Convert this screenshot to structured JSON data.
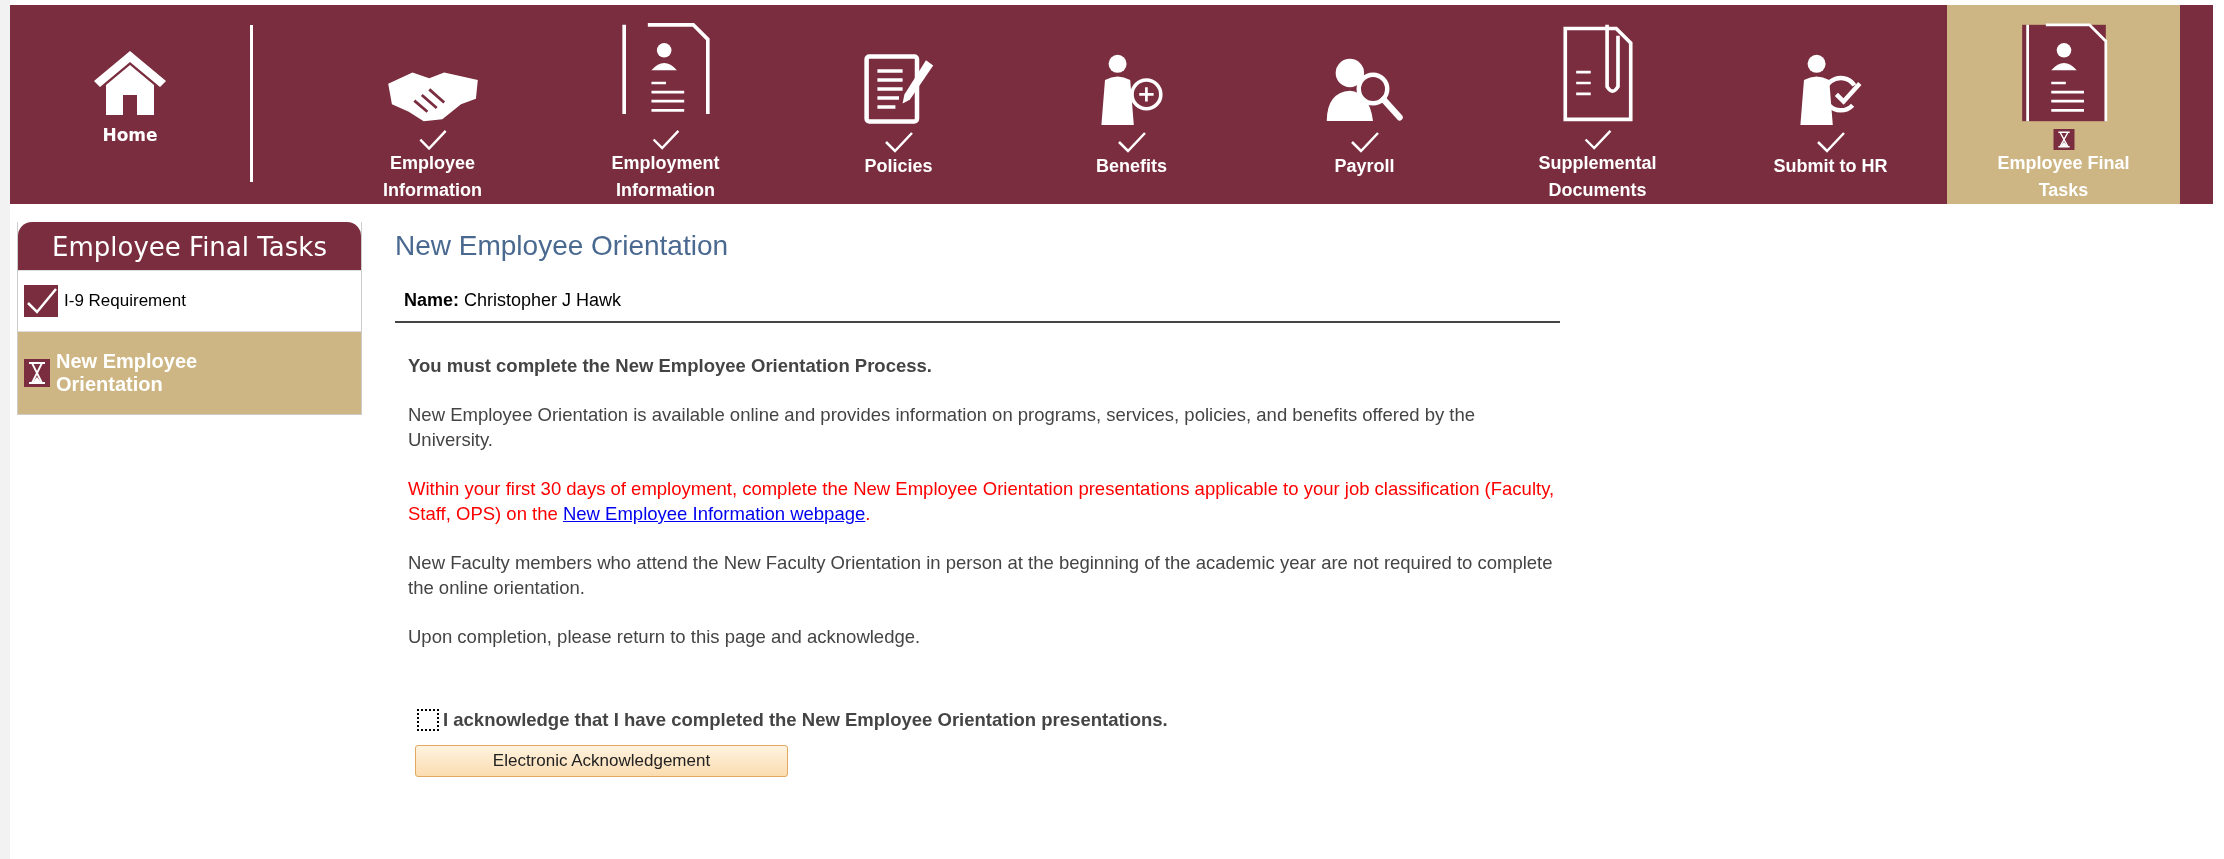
{
  "nav": {
    "home": {
      "label": "Home"
    },
    "tabs": [
      {
        "label": "Employee Information",
        "completed": true,
        "selected": false
      },
      {
        "label": "Employment Information",
        "completed": true,
        "selected": false
      },
      {
        "label": "Policies",
        "completed": true,
        "selected": false
      },
      {
        "label": "Benefits",
        "completed": true,
        "selected": false
      },
      {
        "label": "Payroll",
        "completed": true,
        "selected": false
      },
      {
        "label": "Supplemental Documents",
        "completed": true,
        "selected": false
      },
      {
        "label": "Submit to HR",
        "completed": true,
        "selected": false
      },
      {
        "label": "Employee Final Tasks",
        "completed": false,
        "selected": true
      }
    ]
  },
  "sidebar": {
    "title": "Employee Final Tasks",
    "items": [
      {
        "label": "I-9 Requirement",
        "completed": true,
        "selected": false
      },
      {
        "label": "New Employee Orientation",
        "completed": false,
        "selected": true
      }
    ]
  },
  "content": {
    "title": "New Employee Orientation",
    "name_label": "Name:",
    "name_value": "Christopher J Hawk",
    "paragraphs": [
      {
        "kind": "bold",
        "text": "You must complete the New Employee Orientation Process."
      },
      {
        "kind": "plain",
        "text": "New Employee Orientation is available online and provides information on programs, services, policies, and benefits offered by the University."
      },
      {
        "kind": "alert",
        "text": "Within your first 30 days of employment, complete the New Employee Orientation presentations applicable to your job classification (Faculty, Staff, OPS) on the ",
        "link": "New Employee Information webpage",
        "after": "."
      },
      {
        "kind": "plain",
        "text": "New Faculty members who attend the New Faculty Orientation in person at the beginning of the academic year are not required to complete the online orientation."
      },
      {
        "kind": "plain",
        "text": "Upon completion, please return to this page and acknowledge."
      }
    ],
    "acknowledgement": {
      "label": "I acknowledge that I have completed the New Employee Orientation presentations.",
      "checked": false
    },
    "button": "Electronic Acknowledgement"
  }
}
